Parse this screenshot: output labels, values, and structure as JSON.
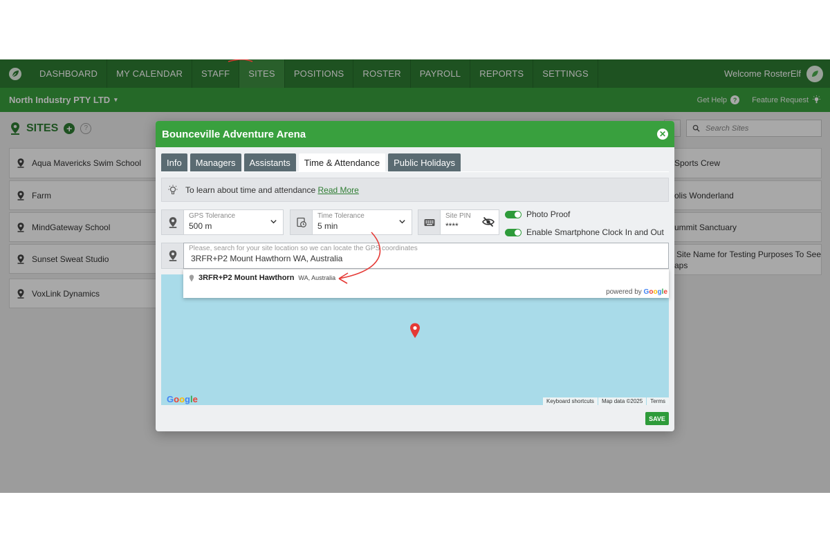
{
  "nav": {
    "items": [
      "DASHBOARD",
      "MY CALENDAR",
      "STAFF",
      "SITES",
      "POSITIONS",
      "ROSTER",
      "PAYROLL",
      "REPORTS",
      "SETTINGS"
    ],
    "active": "SITES",
    "welcome": "Welcome RosterElf"
  },
  "subnav": {
    "company": "North Industry PTY LTD",
    "get_help": "Get Help",
    "feature_request": "Feature Request"
  },
  "page": {
    "title": "SITES",
    "search_placeholder": "Search Sites"
  },
  "sites_left": [
    "Aqua Mavericks Swim School",
    "Farm",
    "MindGateway School",
    "Sunset Sweat Studio",
    "VoxLink Dynamics"
  ],
  "sites_right": [
    "Sports Crew",
    "olis Wonderland",
    "ummit Sanctuary",
    "Site Name for Testing Purposes To See",
    "aps"
  ],
  "modal": {
    "title": "Bounceville Adventure Arena",
    "tabs": [
      "Info",
      "Managers",
      "Assistants",
      "Time & Attendance",
      "Public Holidays"
    ],
    "active_tab": "Time & Attendance",
    "info_text": "To learn about time and attendance",
    "info_link": "Read More",
    "gps_label": "GPS Tolerance",
    "gps_value": "500 m",
    "time_label": "Time Tolerance",
    "time_value": "5 min",
    "pin_label": "Site PIN",
    "pin_value": "****",
    "photo_proof": "Photo Proof",
    "photo_proof_on": true,
    "smartphone_clock": "Enable Smartphone Clock In and Out",
    "smartphone_clock_on": true,
    "location_placeholder": "Please, search for your site location so we can locate the GPS coordinates",
    "location_value": "3RFR+P2 Mount Hawthorn WA, Australia",
    "suggestion_main": "3RFR+P2 Mount Hawthorn",
    "suggestion_secondary": "WA, Australia",
    "powered_by": "powered by",
    "google": "Google",
    "map_footer": [
      "Keyboard shortcuts",
      "Map data ©2025",
      "Terms"
    ],
    "save": "SAVE"
  },
  "colors": {
    "nav_green": "#2e7d32",
    "sub_green": "#39a03e",
    "tab_inactive": "#5a6b72",
    "map_water": "#a9dbe9",
    "pin_red": "#e53935",
    "annotation_red": "#e53935"
  },
  "icons": [
    "leaf-logo-icon",
    "chevron-down-icon",
    "question-icon",
    "lightbulb-icon",
    "location-pin-icon",
    "clock-icon",
    "keyboard-icon",
    "eye-off-icon",
    "search-icon",
    "close-icon",
    "plus-icon",
    "map-marker-icon"
  ]
}
